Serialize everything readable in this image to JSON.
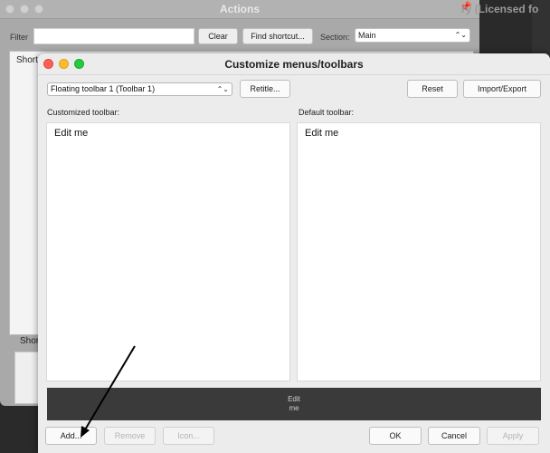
{
  "background_window": {
    "title": "Actions",
    "licensed_text": "ry (Licensed fo",
    "filter_label": "Filter",
    "filter_value": "",
    "clear_label": "Clear",
    "find_shortcut_label": "Find shortcut...",
    "section_label": "Section:",
    "section_value": "Main",
    "list_header": "Short",
    "lower_label": "Shor"
  },
  "dialog": {
    "title": "Customize menus/toolbars",
    "toolbar_select_value": "Floating toolbar 1 (Toolbar 1)",
    "retitle_label": "Retitle...",
    "reset_label": "Reset",
    "import_export_label": "Import/Export",
    "customized_label": "Customized toolbar:",
    "default_label": "Default toolbar:",
    "customized_items": [
      "Edit me"
    ],
    "default_items": [
      "Edit me"
    ],
    "preview_line1": "Edit",
    "preview_line2": "me",
    "buttons": {
      "add": "Add...",
      "remove": "Remove",
      "icon": "Icon...",
      "ok": "OK",
      "cancel": "Cancel",
      "apply": "Apply"
    }
  }
}
